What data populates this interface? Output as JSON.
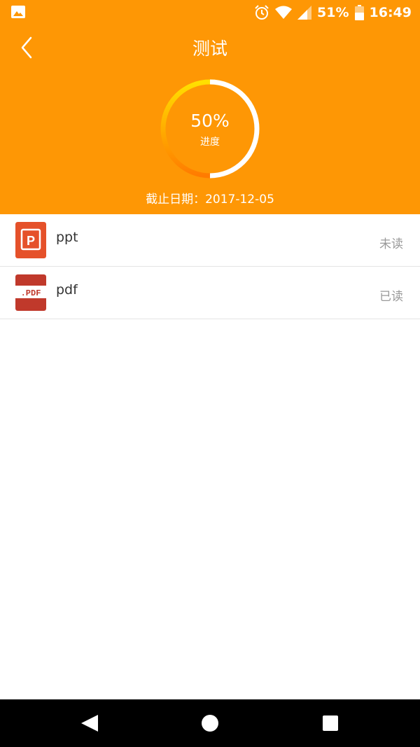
{
  "status_bar": {
    "battery_percent": "51%",
    "time": "16:49",
    "icons": [
      "gallery-icon",
      "alarm-icon",
      "wifi-icon",
      "signal-icon",
      "battery-icon"
    ]
  },
  "header": {
    "title": "测试",
    "background_color": "#fe9705"
  },
  "progress": {
    "value_text": "50%",
    "fraction": 0.5,
    "label": "进度"
  },
  "deadline": {
    "text": "截止日期：2017-12-05"
  },
  "files": [
    {
      "name": "ppt",
      "status": "未读",
      "icon": "ppt-file-icon",
      "icon_color": "#e5512a"
    },
    {
      "name": "pdf",
      "status": "已读",
      "icon": "pdf-file-icon",
      "icon_color": "#c0392b"
    }
  ],
  "system_nav": {
    "buttons": [
      "back-triangle-icon",
      "home-circle-icon",
      "recents-square-icon"
    ]
  }
}
